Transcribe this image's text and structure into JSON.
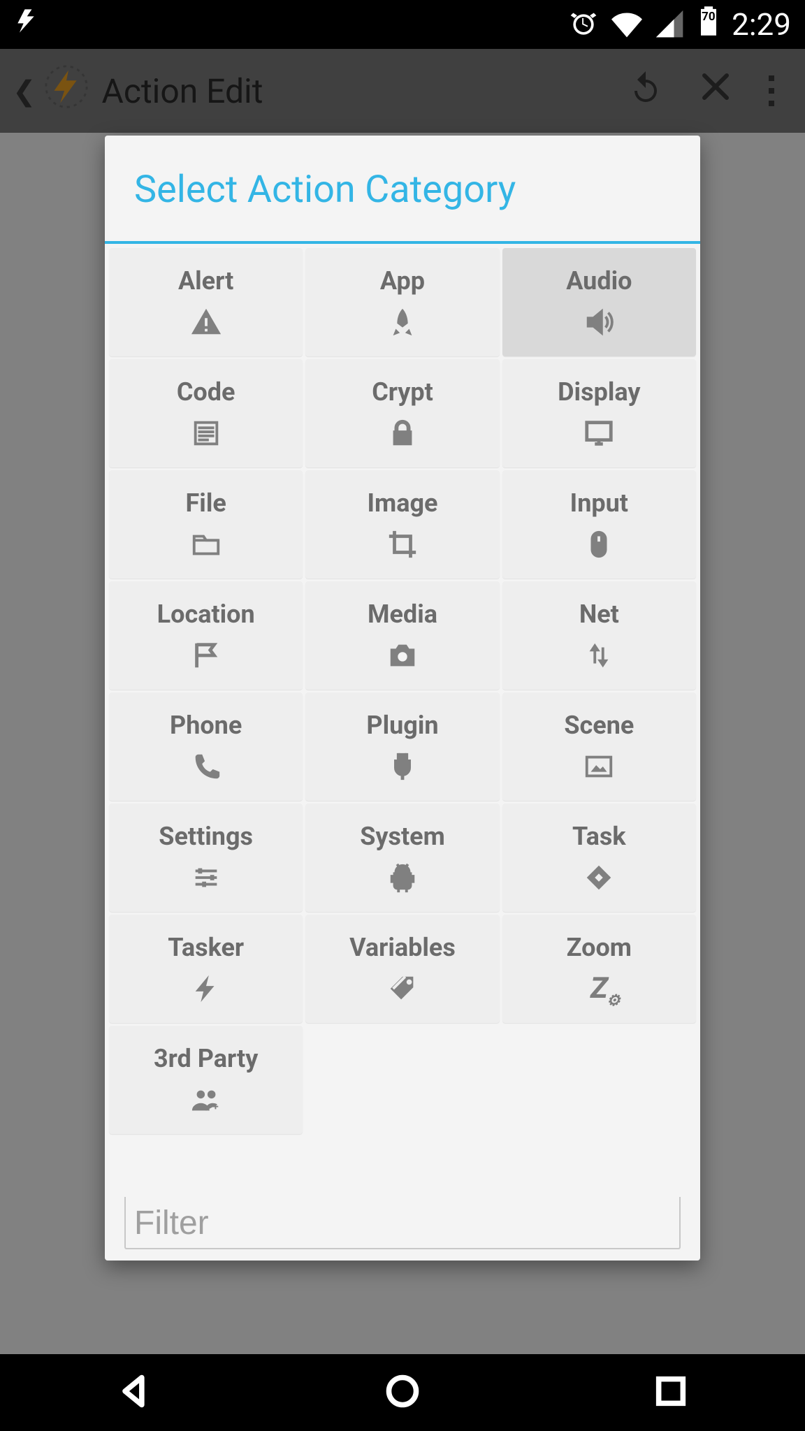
{
  "statusbar": {
    "time": "2:29",
    "battery_pct": "70"
  },
  "appbar": {
    "title": "Action Edit"
  },
  "modal": {
    "title": "Select Action Category",
    "filter_placeholder": "Filter",
    "categories": [
      {
        "label": "Alert",
        "icon": "alert",
        "selected": false
      },
      {
        "label": "App",
        "icon": "rocket",
        "selected": false
      },
      {
        "label": "Audio",
        "icon": "speaker",
        "selected": true
      },
      {
        "label": "Code",
        "icon": "code",
        "selected": false
      },
      {
        "label": "Crypt",
        "icon": "lock",
        "selected": false
      },
      {
        "label": "Display",
        "icon": "monitor",
        "selected": false
      },
      {
        "label": "File",
        "icon": "folder",
        "selected": false
      },
      {
        "label": "Image",
        "icon": "crop",
        "selected": false
      },
      {
        "label": "Input",
        "icon": "mouse",
        "selected": false
      },
      {
        "label": "Location",
        "icon": "flag",
        "selected": false
      },
      {
        "label": "Media",
        "icon": "camera",
        "selected": false
      },
      {
        "label": "Net",
        "icon": "updown",
        "selected": false
      },
      {
        "label": "Phone",
        "icon": "phone",
        "selected": false
      },
      {
        "label": "Plugin",
        "icon": "plug",
        "selected": false
      },
      {
        "label": "Scene",
        "icon": "picture",
        "selected": false
      },
      {
        "label": "Settings",
        "icon": "sliders",
        "selected": false
      },
      {
        "label": "System",
        "icon": "android",
        "selected": false
      },
      {
        "label": "Task",
        "icon": "diamond",
        "selected": false
      },
      {
        "label": "Tasker",
        "icon": "bolt",
        "selected": false
      },
      {
        "label": "Variables",
        "icon": "tag",
        "selected": false
      },
      {
        "label": "Zoom",
        "icon": "zoom",
        "selected": false
      },
      {
        "label": "3rd Party",
        "icon": "people",
        "selected": false
      }
    ]
  }
}
